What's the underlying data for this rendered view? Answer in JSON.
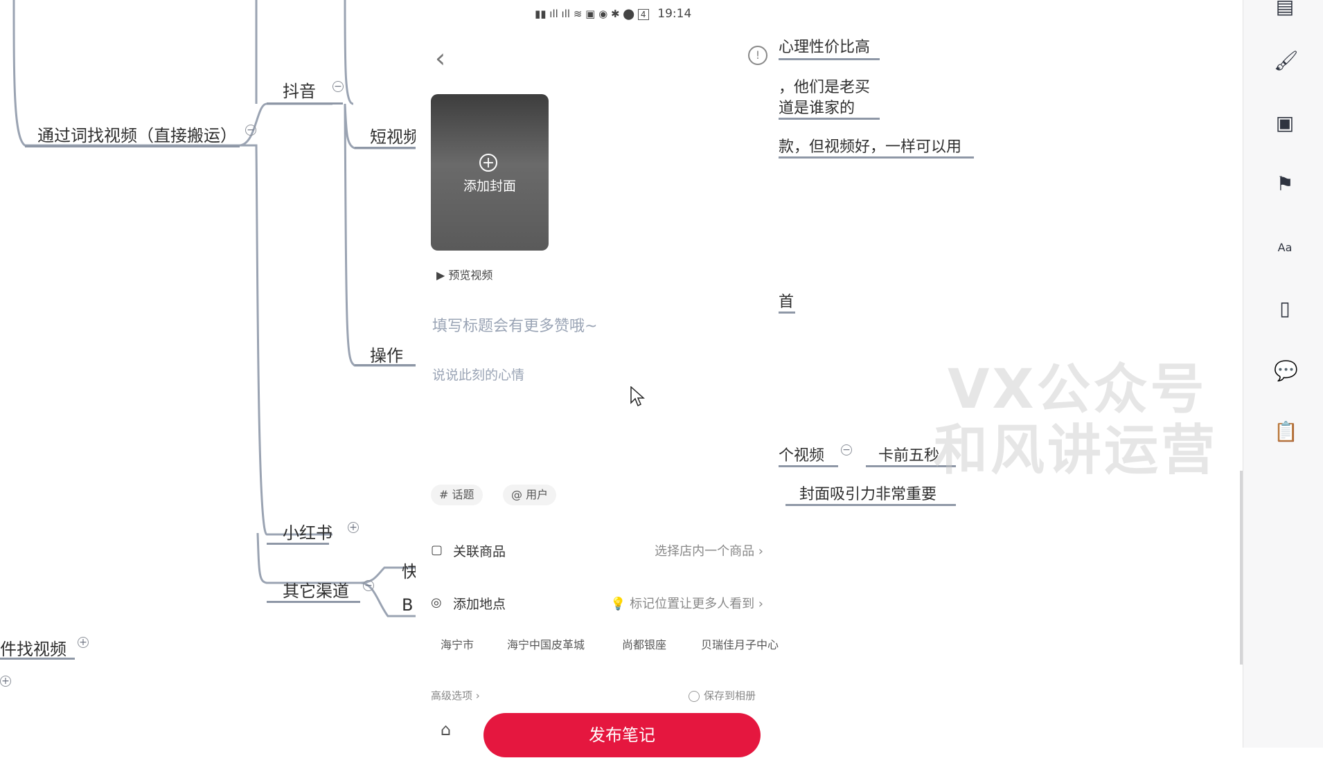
{
  "mindmap": {
    "node_main": "通过词找视频（直接搬运）",
    "node_douyin": "抖音",
    "node_short_video": "短视频",
    "node_operation": "操作",
    "node_xiaohongshu": "小红书",
    "node_other": "其它渠道",
    "node_kuai": "快",
    "node_b": "B",
    "node_find_by_file": "件找视频",
    "right_fragments": {
      "line1": "心理性价比高",
      "line2": "，他们是老买",
      "line3": "道是谁家的",
      "line4": "款，但视频好，一样可以用",
      "line5": "首",
      "line6": "个视频",
      "line7": "卡前五秒",
      "line8": "封面吸引力非常重要"
    }
  },
  "phone": {
    "status": {
      "time": "19:14",
      "battery": "4"
    },
    "add_cover": "添加封面",
    "preview_video": "预览视频",
    "title_placeholder": "填写标题会有更多赞哦~",
    "desc_placeholder": "说说此刻的心情",
    "chip_topic": "# 话题",
    "chip_user": "@ 用户",
    "link_product": {
      "label": "关联商品",
      "right": "选择店内一个商品"
    },
    "add_location": {
      "label": "添加地点",
      "right": "标记位置让更多人看到"
    },
    "locations": [
      "海宁市",
      "海宁中国皮革城",
      "尚都银座",
      "贝瑞佳月子中心"
    ],
    "advanced": "高级选项",
    "save_album": "保存到相册",
    "publish": "发布笔记",
    "accent_color": "#e5173f"
  },
  "watermark": {
    "line1": "VX公众号",
    "line2": "和风讲运营"
  },
  "toolbar": {
    "icons": [
      "layout-icon",
      "brush-icon",
      "image-icon",
      "flag-icon",
      "text-style-icon",
      "document-icon",
      "comment-icon",
      "clipboard-icon"
    ]
  }
}
